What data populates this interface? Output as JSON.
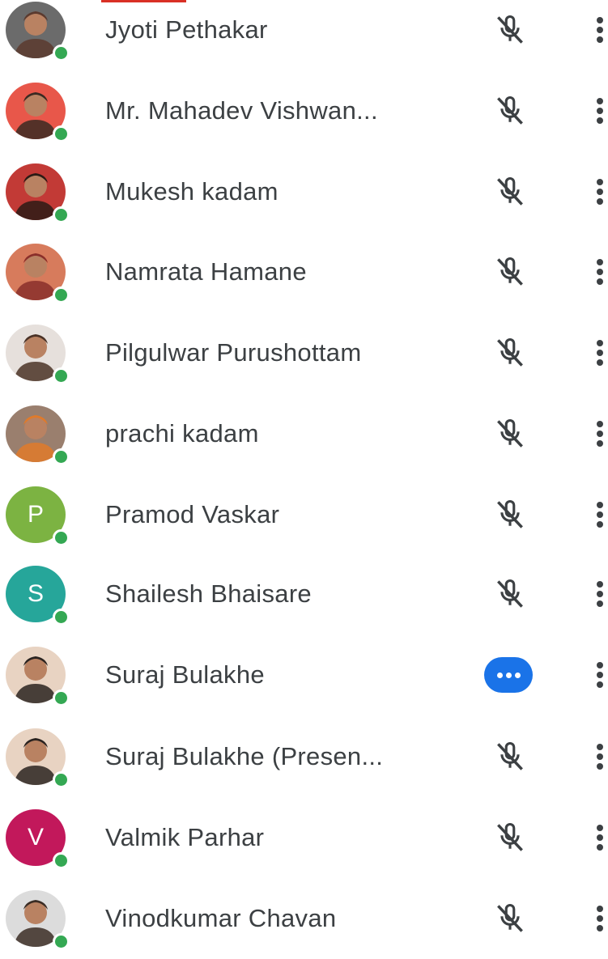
{
  "theme": {
    "presence_color": "#34a853",
    "text_color": "#3c4043",
    "talking_color": "#1a73e8",
    "accent": "#d93025"
  },
  "participants": [
    {
      "name": "Jyoti Pethakar",
      "avatar_type": "photo",
      "avatar_bg": "#6b6b6b",
      "avatar_fg": "#5b3a2e",
      "status": "muted",
      "icon": "mic-off-icon"
    },
    {
      "name": "Mr. Mahadev Vishwan...",
      "avatar_type": "photo",
      "avatar_bg": "#e8574a",
      "avatar_fg": "#3a2a22",
      "status": "muted",
      "icon": "mic-off-icon"
    },
    {
      "name": "Mukesh kadam",
      "avatar_type": "photo",
      "avatar_bg": "#c23a36",
      "avatar_fg": "#2b1b15",
      "status": "muted",
      "icon": "mic-off-icon"
    },
    {
      "name": "Namrata Hamane",
      "avatar_type": "photo",
      "avatar_bg": "#d77b5c",
      "avatar_fg": "#8a2f2a",
      "status": "muted",
      "icon": "mic-off-icon"
    },
    {
      "name": "Pilgulwar Purushottam",
      "avatar_type": "photo",
      "avatar_bg": "#e6e0dc",
      "avatar_fg": "#4a3226",
      "status": "muted",
      "icon": "mic-off-icon"
    },
    {
      "name": "prachi kadam",
      "avatar_type": "photo",
      "avatar_bg": "#9a7f6e",
      "avatar_fg": "#e07a2a",
      "status": "muted",
      "icon": "mic-off-icon"
    },
    {
      "name": "Pramod Vaskar",
      "avatar_type": "initial",
      "initial": "P",
      "avatar_bg": "#7cb342",
      "status": "muted",
      "icon": "mic-off-icon"
    },
    {
      "name": "Shailesh Bhaisare",
      "avatar_type": "initial",
      "initial": "S",
      "avatar_bg": "#26a69a",
      "status": "muted",
      "icon": "mic-off-icon"
    },
    {
      "name": "Suraj Bulakhe",
      "avatar_type": "photo",
      "avatar_bg": "#e8d3c2",
      "avatar_fg": "#2a2320",
      "status": "talking",
      "icon": "talking-indicator-icon"
    },
    {
      "name": "Suraj Bulakhe (Presen...",
      "avatar_type": "photo",
      "avatar_bg": "#e8d3c2",
      "avatar_fg": "#2a2320",
      "status": "muted",
      "icon": "mic-off-icon"
    },
    {
      "name": "Valmik Parhar",
      "avatar_type": "initial",
      "initial": "V",
      "avatar_bg": "#c2185b",
      "status": "muted",
      "icon": "mic-off-icon"
    },
    {
      "name": "Vinodkumar Chavan",
      "avatar_type": "photo",
      "avatar_bg": "#dcdcdc",
      "avatar_fg": "#3b2d25",
      "status": "muted",
      "icon": "mic-off-icon"
    }
  ],
  "more_icon": "more-vert-icon"
}
